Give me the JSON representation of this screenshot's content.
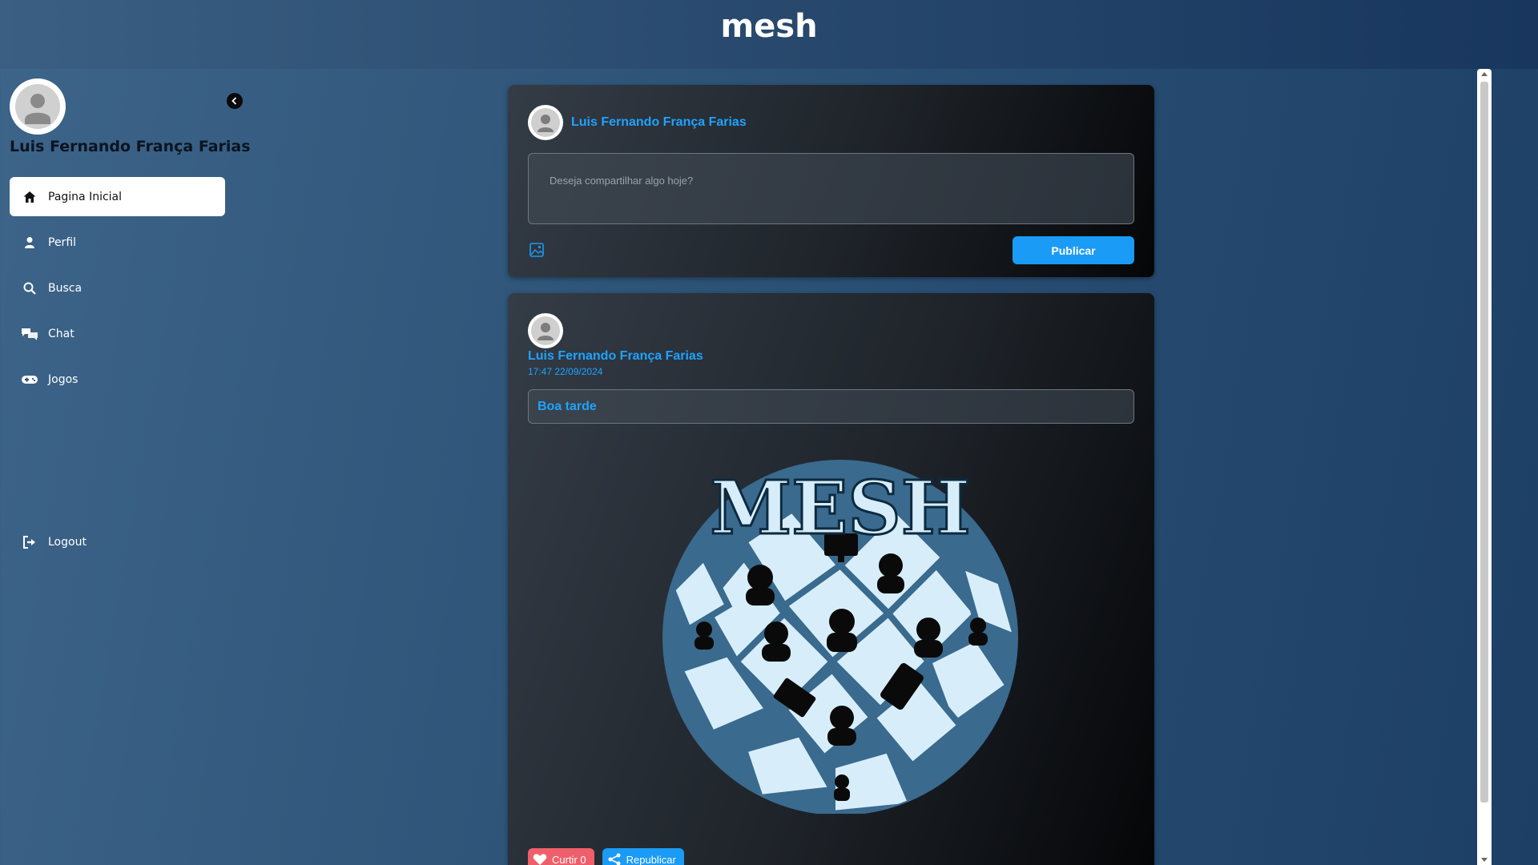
{
  "app": {
    "title": "mesh"
  },
  "sidebar": {
    "user_name": "Luis Fernando França Farias",
    "items": [
      {
        "label": "Pagina Inicial",
        "icon": "home-icon",
        "active": true
      },
      {
        "label": "Perfil",
        "icon": "user-icon",
        "active": false
      },
      {
        "label": "Busca",
        "icon": "search-icon",
        "active": false
      },
      {
        "label": "Chat",
        "icon": "chat-icon",
        "active": false
      },
      {
        "label": "Jogos",
        "icon": "gamepad-icon",
        "active": false
      }
    ],
    "logout_label": "Logout"
  },
  "composer": {
    "author": "Luis Fernando França Farias",
    "placeholder": "Deseja compartilhar algo hoje?",
    "publish_label": "Publicar"
  },
  "post": {
    "author": "Luis Fernando França Farias",
    "timestamp": "17:47 22/09/2024",
    "text": "Boa tarde",
    "image_logo_text": "MESH",
    "like_label": "Curtir 0",
    "repost_label": "Republicar"
  },
  "colors": {
    "accent": "#1a9bf5",
    "like": "#ef5f6b",
    "link": "#1fa3ff"
  }
}
